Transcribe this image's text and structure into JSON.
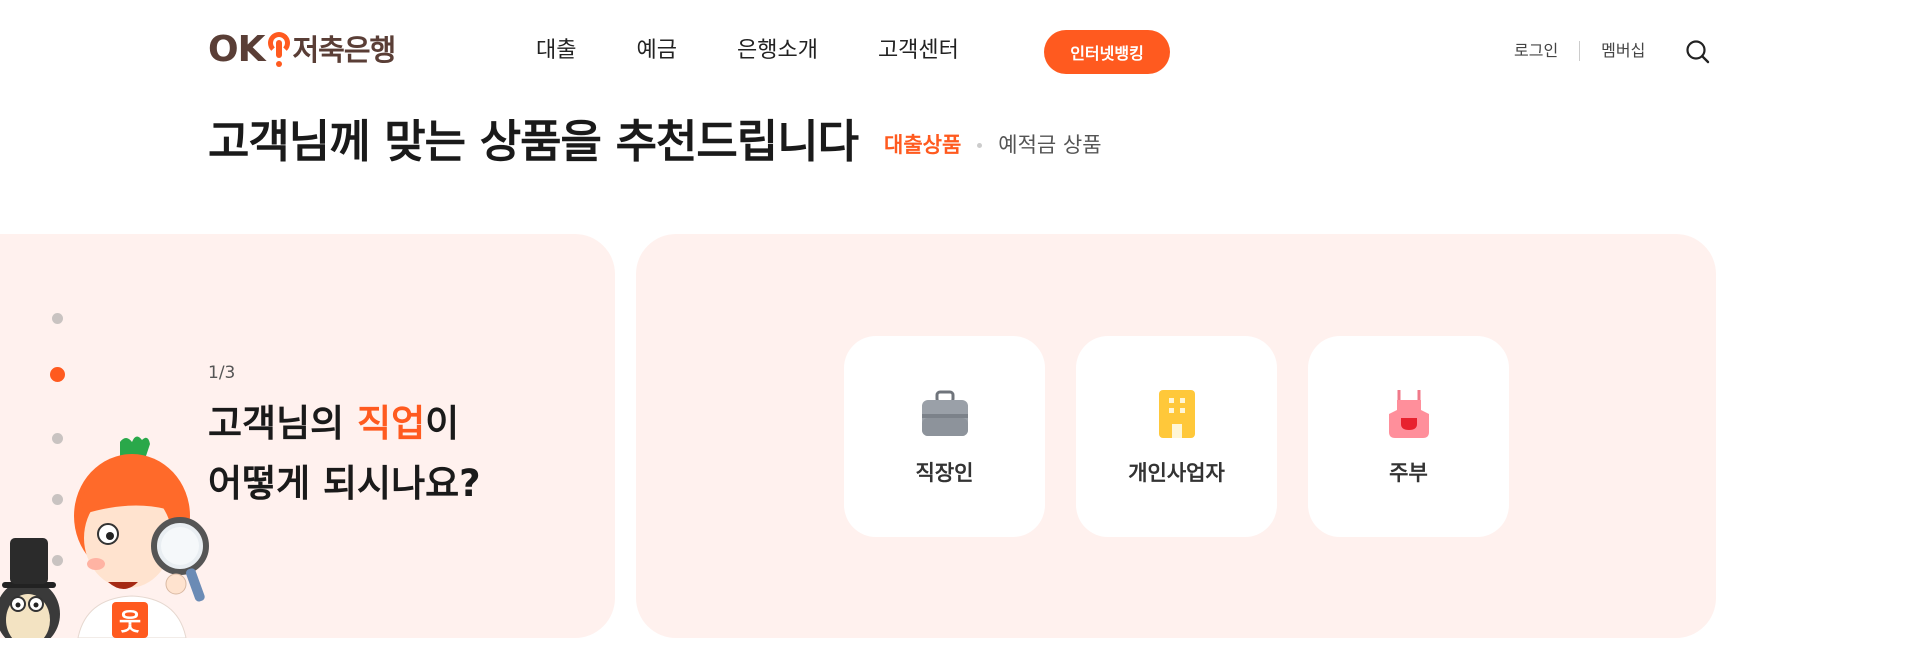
{
  "header": {
    "logo": {
      "brand": "OK",
      "name": "저축은행"
    },
    "nav": [
      {
        "label": "대출"
      },
      {
        "label": "예금"
      },
      {
        "label": "은행소개"
      },
      {
        "label": "고객센터"
      }
    ],
    "internet_banking_label": "인터넷뱅킹",
    "login_label": "로그인",
    "membership_label": "멤버십",
    "search_icon": "search-icon"
  },
  "recommend": {
    "title": "고객님께 맞는 상품을 추천드립니다",
    "tabs": [
      {
        "label": "대출상품",
        "active": true
      },
      {
        "label": "예적금 상품",
        "active": false
      }
    ]
  },
  "step": {
    "counter": "1/3",
    "question_line1_prefix": "고객님의 ",
    "question_line1_highlight": "직업",
    "question_line1_suffix": "이",
    "question_line2": "어떻게 되시나요?",
    "dots": [
      false,
      true,
      false,
      false,
      false
    ]
  },
  "options": [
    {
      "label": "직장인",
      "icon": "briefcase-icon"
    },
    {
      "label": "개인사업자",
      "icon": "building-icon"
    },
    {
      "label": "주부",
      "icon": "apron-icon"
    }
  ],
  "colors": {
    "accent": "#ff5a1f",
    "panel_bg": "#fff1ee",
    "logo_brown": "#5a3e36"
  }
}
